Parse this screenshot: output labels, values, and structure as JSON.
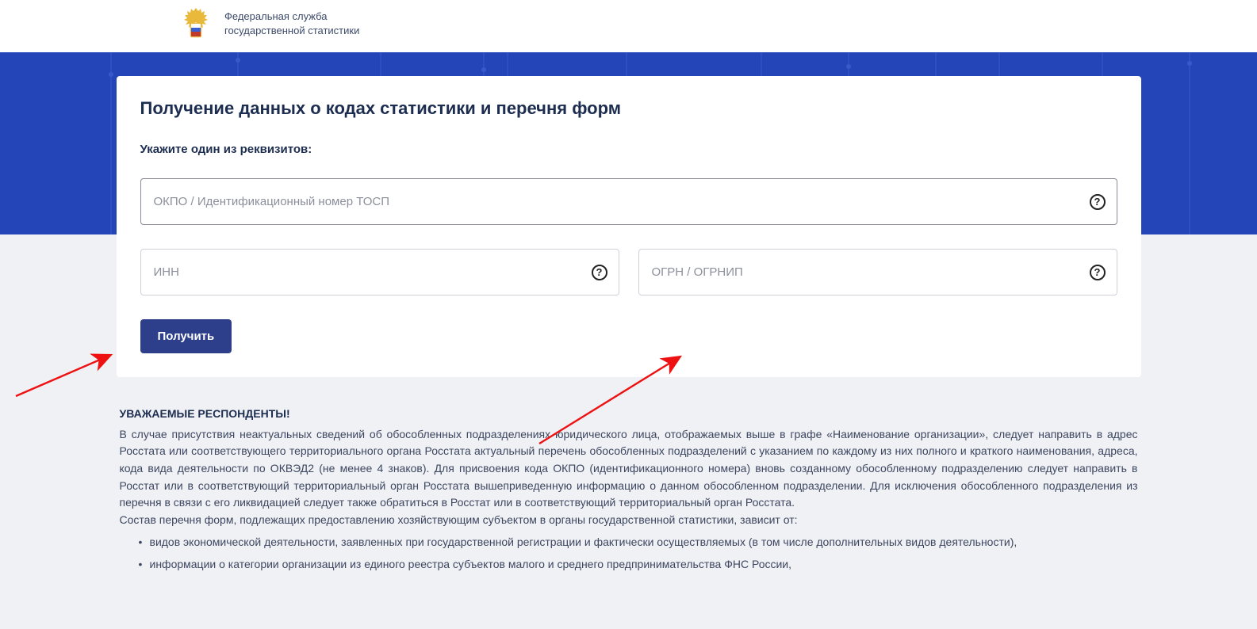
{
  "header": {
    "org_line1": "Федеральная служба",
    "org_line2": "государственной статистики"
  },
  "card": {
    "title": "Получение данных о кодах статистики и перечня форм",
    "subtitle": "Укажите один из реквизитов:",
    "field_okpo_placeholder": "ОКПО / Идентификационный номер ТОСП",
    "field_inn_placeholder": "ИНН",
    "field_ogrn_placeholder": "ОГРН / ОГРНИП",
    "submit_label": "Получить",
    "help_glyph": "?"
  },
  "info": {
    "heading": "УВАЖАЕМЫЕ РЕСПОНДЕНТЫ!",
    "para1": "В случае присутствия неактуальных сведений об обособленных подразделениях юридического лица, отображаемых выше в графе «Наименование организации», следует направить в адрес Росстата или соответствующего территориального органа Росстата актуальный перечень обособленных подразделений с указанием по каждому из них полного и краткого наименования, адреса, кода вида деятельности по ОКВЭД2 (не менее 4 знаков). Для присвоения кода ОКПО (идентификационного номера) вновь созданному обособленному подразделению следует направить в Росстат или в соответствующий территориальный орган Росстата вышеприведенную информацию о данном обособленном подразделении. Для исключения обособленного подразделения из перечня в связи с его ликвидацией следует также обратиться в Росстат или в соответствующий территориальный орган Росстата.",
    "para2": "Состав перечня форм, подлежащих предоставлению хозяйствующим субъектом в органы государственной статистики, зависит от:",
    "bullets": [
      "видов экономической деятельности, заявленных при государственной регистрации и фактически осуществляемых (в том числе дополнительных видов деятельности),",
      "информации о категории организации из единого реестра субъектов малого и среднего предпринимательства ФНС России,"
    ]
  }
}
